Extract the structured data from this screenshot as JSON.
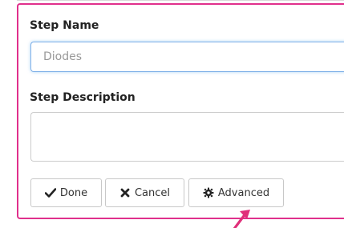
{
  "form": {
    "step_name_label": "Step Name",
    "step_name_value": "Diodes",
    "step_description_label": "Step Description",
    "step_description_value": ""
  },
  "actions": {
    "done_label": "Done",
    "cancel_label": "Cancel",
    "advanced_label": "Advanced"
  },
  "icons": {
    "done": "check-icon",
    "cancel": "close-icon",
    "advanced": "gear-icon",
    "annotation": "arrow-icon"
  },
  "colors": {
    "highlight_border": "#e0308c",
    "focus_border": "#7fb0e8",
    "annotation_arrow": "#e0307a"
  }
}
